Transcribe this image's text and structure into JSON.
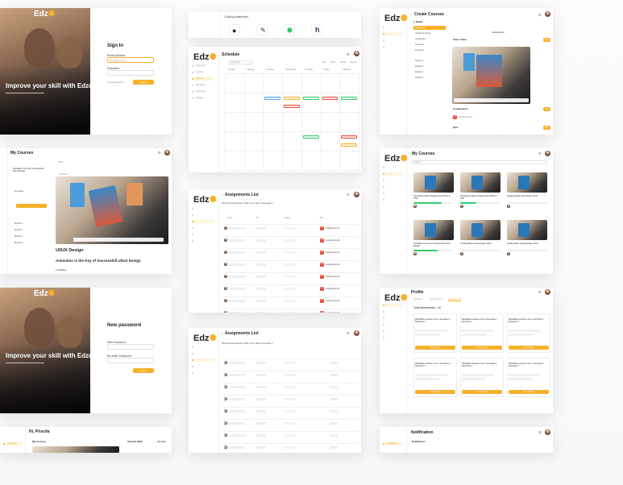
{
  "brand": {
    "name": "Edz",
    "accent": "#f7b02a"
  },
  "signin": {
    "title": "Sign In",
    "email_label": "Email Address",
    "email_value": "edz@gmail.com",
    "password_label": "Password",
    "forgot": "Forgot password?",
    "button": "Sign In",
    "hero_title": "Improve your skill with Edzo!"
  },
  "newpass": {
    "title": "New password",
    "new_label": "New Password",
    "confirm_label": "Re-enter Password",
    "button": "Save",
    "hero_title": "Improve your skill with Edzo!"
  },
  "coding": {
    "title": "Coding platforms"
  },
  "schedule": {
    "title": "Schedule",
    "month": "May 2023",
    "views": [
      "Day",
      "Week",
      "Month",
      "Agenda"
    ],
    "days": [
      "Sunday",
      "Monday",
      "Tuesday",
      "Wednesday",
      "Thursday",
      "Friday",
      "Saturday"
    ],
    "sidebar": [
      "Dashboard",
      "Courses",
      "Schedule",
      "Messages",
      "Notification",
      "Settings"
    ]
  },
  "mycourses_left": {
    "title": "My Courses",
    "course_heading": "Animation is the Key of Successful UI/UX Design",
    "back": "Back",
    "section": "Animation",
    "heading1": "UI/UX Design",
    "heading2": "Animation is the Key of Successfull UI/UX Design",
    "sub": "1.Drafting",
    "modules": [
      "Animation",
      "Module 2",
      "Module 3",
      "Module 4",
      "Module 5"
    ]
  },
  "create": {
    "title": "Create Courses",
    "section": "1. Module",
    "intro": "Introduction",
    "class_video": "Class Video",
    "assignments": "Assignments",
    "assignment_item": "Assignment.pdf",
    "quiz": "Quiz",
    "add": "Add",
    "items": [
      "Introduction",
      "Variable & Design",
      "Typography",
      "Animation",
      "Prototype",
      "Module 2",
      "Module 3",
      "Module 4",
      "Module 5"
    ]
  },
  "mycourses_right": {
    "title": "My Courses",
    "search": "Search",
    "cards": [
      "Introduction Basic Programming HTML & CSS",
      "Introduction Basic Programming HTML & CSS",
      "Creating Mobile App Design UI/UX",
      "Animation is the Key of Successful UI/UX Design",
      "Creating Best Landing Page UI/UX",
      "Creating Best Landing Page UI/UX"
    ]
  },
  "assign1": {
    "title": "Assignments List",
    "subtitle": "Write the final structure of API in next class in Semester 1",
    "columns": [
      "Name",
      "ID",
      "Status",
      "File"
    ],
    "file": "Assignment.pdf",
    "rows": 8
  },
  "assign2": {
    "title": "Assignments List",
    "subtitle": "Write the final structure of API in next class in Semester 1",
    "rows": 8
  },
  "profile": {
    "title": "Profile",
    "tabs": [
      "General",
      "Assignment",
      "Assessment"
    ],
    "total": "Total Assessment : 10",
    "card_title": "Affordable structure of C++ and Java in Semester 1",
    "button": "View Details"
  },
  "dashboard": {
    "greeting": "Hi, Priscila",
    "section": "My Courses",
    "date": "18 April 2023",
    "day": "Monday",
    "side": "Dashboard"
  },
  "notification": {
    "title": "Notification",
    "section": "Notification",
    "side": "Dashboard"
  }
}
